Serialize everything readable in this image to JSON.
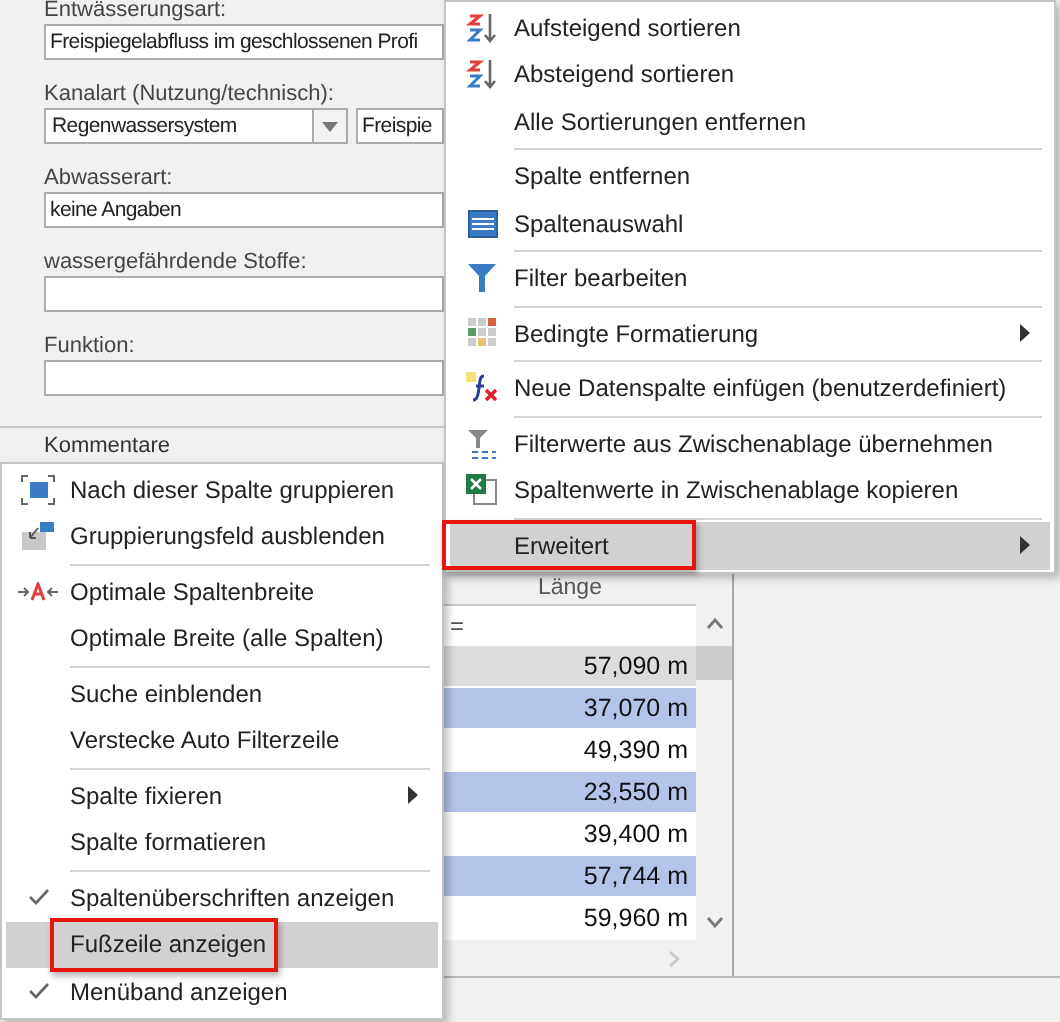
{
  "form": {
    "fields": [
      {
        "label": "Entwässerungsart:",
        "kind": "text",
        "value": "Freispiegelabfluss im geschlossenen Profi"
      },
      {
        "label": "Kanalart (Nutzung/technisch):",
        "kind": "combo",
        "value": "Regenwassersystem",
        "value_2": "Freispie"
      },
      {
        "label": "Abwasserart:",
        "kind": "text",
        "value": "keine Angaben"
      },
      {
        "label": "wassergefährdende Stoffe:",
        "kind": "text"
      },
      {
        "label": "Funktion:",
        "kind": "text"
      }
    ],
    "section_header": "Kommentare"
  },
  "grid": {
    "columns": [
      {
        "header": "Länge"
      }
    ],
    "filter": "=",
    "rows": [
      {
        "cells": [
          "57,090 m"
        ],
        "selected": false,
        "focused": true
      },
      {
        "cells": [
          "37,070 m"
        ],
        "selected": true,
        "focused": false
      },
      {
        "cells": [
          "49,390 m"
        ],
        "selected": false,
        "focused": false
      },
      {
        "cells": [
          "23,550 m"
        ],
        "selected": true,
        "focused": false
      },
      {
        "cells": [
          "39,400 m"
        ],
        "selected": false,
        "focused": false
      },
      {
        "cells": [
          "57,744 m"
        ],
        "selected": true,
        "focused": false
      },
      {
        "cells": [
          "59,960 m"
        ],
        "selected": false,
        "focused": false
      }
    ]
  },
  "column_menu": {
    "groups": [
      [
        {
          "label": "Aufsteigend sortieren",
          "submenu": false,
          "selected": false,
          "outlined": false
        },
        {
          "label": "Absteigend sortieren",
          "submenu": false,
          "selected": false,
          "outlined": false
        },
        {
          "label": "Alle Sortierungen entfernen",
          "submenu": false,
          "selected": false,
          "outlined": false
        }
      ],
      [
        {
          "label": "Spalte entfernen",
          "submenu": false,
          "selected": false,
          "outlined": false
        },
        {
          "label": "Spaltenauswahl",
          "submenu": false,
          "selected": false,
          "outlined": false
        }
      ],
      [
        {
          "label": "Filter bearbeiten",
          "submenu": false,
          "selected": false,
          "outlined": false
        }
      ],
      [
        {
          "label": "Bedingte Formatierung",
          "submenu": true,
          "selected": false,
          "outlined": false
        }
      ],
      [
        {
          "label": "Neue Datenspalte einfügen (benutzerdefiniert)",
          "submenu": false,
          "selected": false,
          "outlined": false
        }
      ],
      [
        {
          "label": "Filterwerte aus Zwischenablage übernehmen",
          "submenu": false,
          "selected": false,
          "outlined": false
        },
        {
          "label": "Spaltenwerte in Zwischenablage kopieren",
          "submenu": false,
          "selected": false,
          "outlined": false
        }
      ],
      [
        {
          "label": "Erweitert",
          "submenu": true,
          "selected": true,
          "outlined": true
        }
      ]
    ]
  },
  "header_menu": {
    "groups": [
      [
        {
          "label": "Nach dieser Spalte gruppieren",
          "submenu": false,
          "checked": false,
          "selected": false,
          "outlined": false
        },
        {
          "label": "Gruppierungsfeld ausblenden",
          "submenu": false,
          "checked": false,
          "selected": false,
          "outlined": false
        }
      ],
      [
        {
          "label": "Optimale Spaltenbreite",
          "submenu": false,
          "checked": false,
          "selected": false,
          "outlined": false
        },
        {
          "label": "Optimale Breite (alle Spalten)",
          "submenu": false,
          "checked": false,
          "selected": false,
          "outlined": false
        }
      ],
      [
        {
          "label": "Suche einblenden",
          "submenu": false,
          "checked": false,
          "selected": false,
          "outlined": false
        },
        {
          "label": "Verstecke Auto Filterzeile",
          "submenu": false,
          "checked": false,
          "selected": false,
          "outlined": false
        }
      ],
      [
        {
          "label": "Spalte fixieren",
          "submenu": true,
          "checked": false,
          "selected": false,
          "outlined": false
        },
        {
          "label": "Spalte formatieren",
          "submenu": false,
          "checked": false,
          "selected": false,
          "outlined": false
        }
      ],
      [
        {
          "label": "Spaltenüberschriften anzeigen",
          "submenu": false,
          "checked": true,
          "selected": false,
          "outlined": false
        },
        {
          "label": "Fußzeile anzeigen",
          "submenu": false,
          "checked": false,
          "selected": true,
          "outlined": true
        },
        {
          "label": "Menüband anzeigen",
          "submenu": false,
          "checked": true,
          "selected": false,
          "outlined": false
        }
      ]
    ]
  }
}
